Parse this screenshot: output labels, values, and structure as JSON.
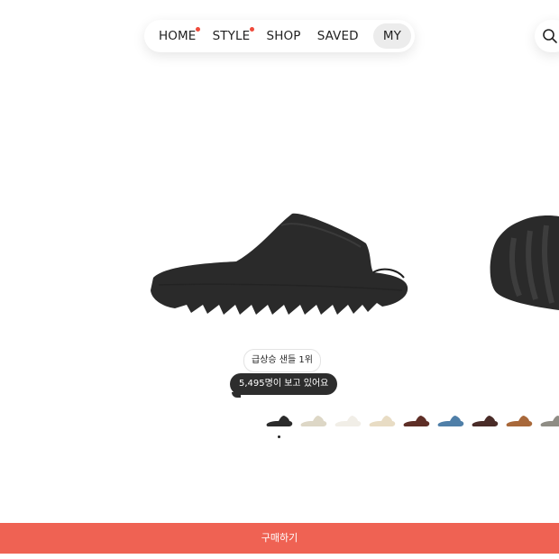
{
  "nav": {
    "items": [
      {
        "label": "HOME",
        "new_dot": true
      },
      {
        "label": "STYLE",
        "new_dot": true
      },
      {
        "label": "SHOP",
        "new_dot": false
      },
      {
        "label": "SAVED",
        "new_dot": false
      },
      {
        "label": "MY",
        "new_dot": false,
        "active": true
      }
    ],
    "dot_color": "#ef4b3c"
  },
  "search": {
    "icon": "search-icon"
  },
  "product": {
    "rank_badge": "급상승 샌들 1위",
    "viewers_text": "5,495명이 보고 있어요",
    "image_color": "#2a2a2a"
  },
  "color_options": [
    {
      "name": "black",
      "color": "#2b2b2b"
    },
    {
      "name": "bone",
      "color": "#ddd7c6"
    },
    {
      "name": "pure",
      "color": "#f1eee7"
    },
    {
      "name": "cream",
      "color": "#e8dcc4"
    },
    {
      "name": "brown",
      "color": "#5e2e26"
    },
    {
      "name": "blue",
      "color": "#4f7fa8"
    },
    {
      "name": "dark-brown",
      "color": "#4a2c28"
    },
    {
      "name": "tan",
      "color": "#a8683a"
    },
    {
      "name": "grey",
      "color": "#8f8d85"
    }
  ],
  "carousel": {
    "current_page": 1
  },
  "buy_button": {
    "label": "구매하기",
    "color": "#ef6253"
  }
}
